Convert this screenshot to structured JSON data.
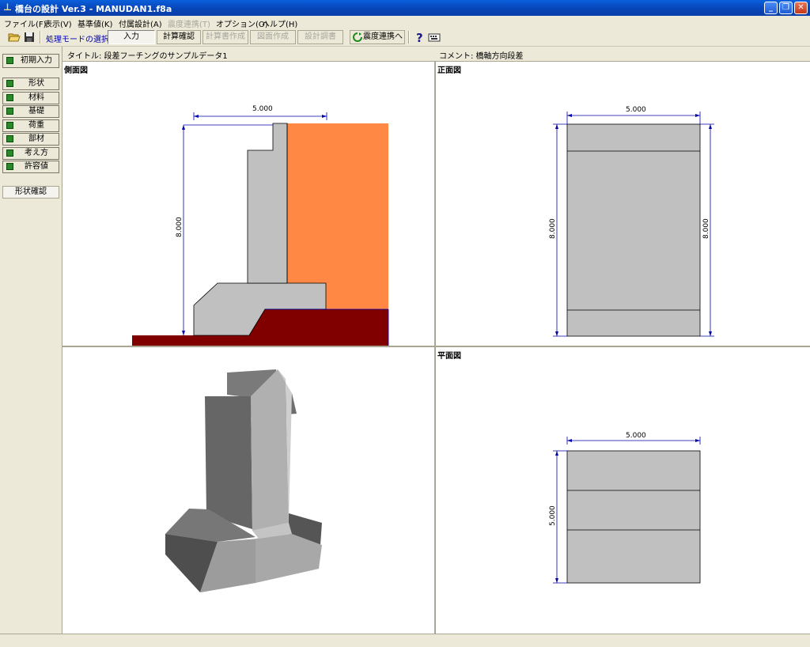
{
  "window": {
    "title": "橋台の設計 Ver.3 - MANUDAN1.f8a",
    "app_icon": "abutment-app-icon",
    "controls": [
      "minimize-icon",
      "restore-icon",
      "close-icon"
    ],
    "colors": {
      "titlebar": "#0A4FC8",
      "close": "#D9532B"
    }
  },
  "menu": {
    "items": [
      {
        "label": "ファイル(F)",
        "enabled": true
      },
      {
        "label": "表示(V)",
        "enabled": true
      },
      {
        "label": "基準値(K)",
        "enabled": true
      },
      {
        "label": "付属設計(A)",
        "enabled": true
      },
      {
        "label": "震度連携(T)",
        "enabled": false
      },
      {
        "label": "オプション(O)",
        "enabled": true
      },
      {
        "label": "ヘルプ(H)",
        "enabled": true
      }
    ]
  },
  "toolbar": {
    "mode_label": "処理モードの選択",
    "buttons": [
      {
        "label": "入力",
        "state": "pressed"
      },
      {
        "label": "計算確認",
        "state": "normal"
      },
      {
        "label": "計算書作成",
        "state": "disabled"
      },
      {
        "label": "図面作成",
        "state": "disabled"
      },
      {
        "label": "設計調書",
        "state": "disabled"
      },
      {
        "label": "震度連携へ",
        "state": "normal"
      }
    ],
    "icons": [
      "open-folder-icon",
      "save-icon",
      "refresh-icon",
      "help-icon",
      "keyboard-icon"
    ]
  },
  "sidebar": {
    "initial_input": "初期入力",
    "items": [
      "形状",
      "材料",
      "基礎",
      "荷重",
      "部材",
      "考え方",
      "許容値"
    ],
    "check_color": "#2A8A2A",
    "tab": "形状確認"
  },
  "info": {
    "title_text": "タイトル: 段差フーチングのサンプルデータ1",
    "comment_text": "コメント: 橋軸方向段差"
  },
  "views": {
    "side": {
      "label": "側面図",
      "width_dim": "5.000",
      "height_dim": "8.000",
      "colors": {
        "concrete": "#C0C0C0",
        "soil": "#FF8844",
        "ground": "#800000",
        "dim": "#0000AA"
      }
    },
    "front": {
      "label": "正面図",
      "width_dim": "5.000",
      "height_dim_left": "8.000",
      "height_dim_right": "8.000"
    },
    "plan": {
      "label": "平面図",
      "width_dim": "5.000",
      "height_dim": "5.000"
    },
    "iso": {
      "label": ""
    }
  }
}
